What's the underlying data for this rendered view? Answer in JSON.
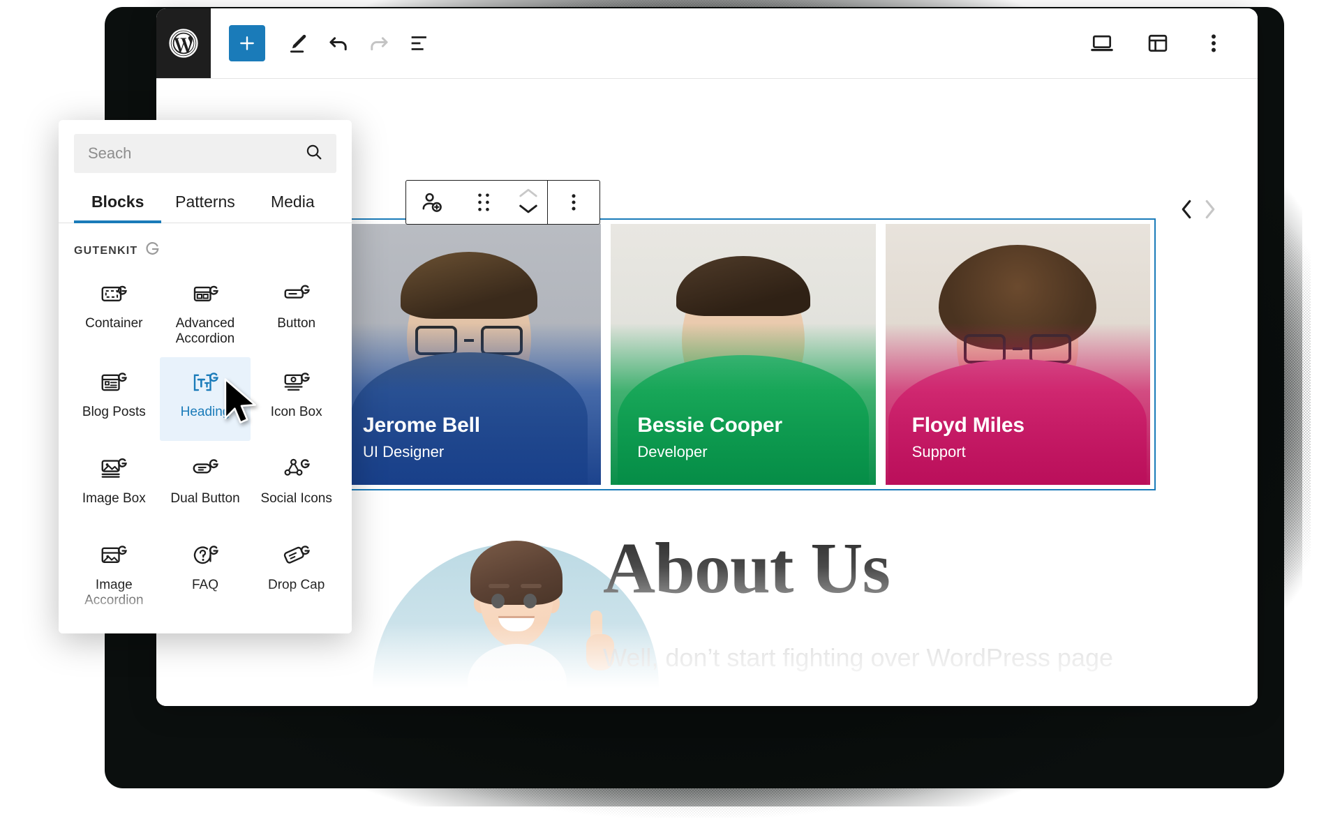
{
  "editor": {
    "toolbar": {
      "logo_icon": "wordpress-logo-icon",
      "add_block_label": "+",
      "add_block_icon": "plus-icon",
      "tools_icon": "pencil-edit-icon",
      "undo_icon": "undo-arrow-icon",
      "redo_icon": "redo-arrow-icon",
      "list_view_icon": "document-overview-icon",
      "preview_icon": "laptop-preview-icon",
      "settings_icon": "sidebar-settings-icon",
      "options_icon": "three-dot-options-icon"
    },
    "block_toolbar": {
      "block_type_icon": "team-member-add-icon",
      "drag_icon": "six-dot-drag-handle-icon",
      "move_up_icon": "chevron-up-icon",
      "move_down_icon": "chevron-down-icon",
      "more_icon": "three-dot-options-icon"
    },
    "carousel": {
      "prev_icon": "chevron-left-icon",
      "next_icon": "chevron-right-icon"
    }
  },
  "inserter": {
    "search": {
      "value": "",
      "placeholder": "Seach",
      "icon": "search-icon"
    },
    "tabs": [
      {
        "label": "Blocks",
        "active": true
      },
      {
        "label": "Patterns",
        "active": false
      },
      {
        "label": "Media",
        "active": false
      }
    ],
    "section": {
      "title": "GUTENKIT",
      "badge_icon": "gutenkit-g-icon"
    },
    "blocks": [
      {
        "label": "Container",
        "icon": "container-icon",
        "selected": false,
        "faded": false
      },
      {
        "label": "Advanced Accordion",
        "icon": "advanced-accordion-icon",
        "selected": false,
        "faded": false
      },
      {
        "label": "Button",
        "icon": "button-icon",
        "selected": false,
        "faded": false
      },
      {
        "label": "Blog Posts",
        "icon": "blog-posts-icon",
        "selected": false,
        "faded": false
      },
      {
        "label": "Heading",
        "icon": "heading-icon",
        "selected": true,
        "faded": false
      },
      {
        "label": "Icon Box",
        "icon": "icon-box-icon",
        "selected": false,
        "faded": false
      },
      {
        "label": "Image Box",
        "icon": "image-box-icon",
        "selected": false,
        "faded": false
      },
      {
        "label": "Dual Button",
        "icon": "dual-button-icon",
        "selected": false,
        "faded": false
      },
      {
        "label": "Social Icons",
        "icon": "social-icons-icon",
        "selected": false,
        "faded": false
      },
      {
        "label": "Image Accordion",
        "icon": "image-accordion-icon",
        "selected": false,
        "faded": false
      },
      {
        "label": "FAQ",
        "icon": "faq-icon",
        "selected": false,
        "faded": false
      },
      {
        "label": "Drop Cap",
        "icon": "drop-cap-icon",
        "selected": false,
        "faded": false
      },
      {
        "label": "",
        "icon": "share-icon",
        "selected": false,
        "faded": true
      },
      {
        "label": "",
        "icon": "back-to-top-icon",
        "selected": false,
        "faded": true
      },
      {
        "label": "",
        "icon": "basket-icon",
        "selected": false,
        "faded": true
      }
    ]
  },
  "content": {
    "team_members": [
      {
        "name": "Jerome Bell",
        "role": "UI Designer",
        "accent": "#1f4fa3"
      },
      {
        "name": "Bessie Cooper",
        "role": "Developer",
        "accent": "#07a04a"
      },
      {
        "name": "Floyd Miles",
        "role": "Support",
        "accent": "#cf1464"
      }
    ],
    "about": {
      "title": "About Us",
      "subtitle": "Well, don’t start fighting over WordPress page"
    }
  },
  "colors": {
    "brand_blue": "#1a7bb9",
    "selection_blue": "#1a7bb9",
    "dark": "#1e1e1e"
  }
}
